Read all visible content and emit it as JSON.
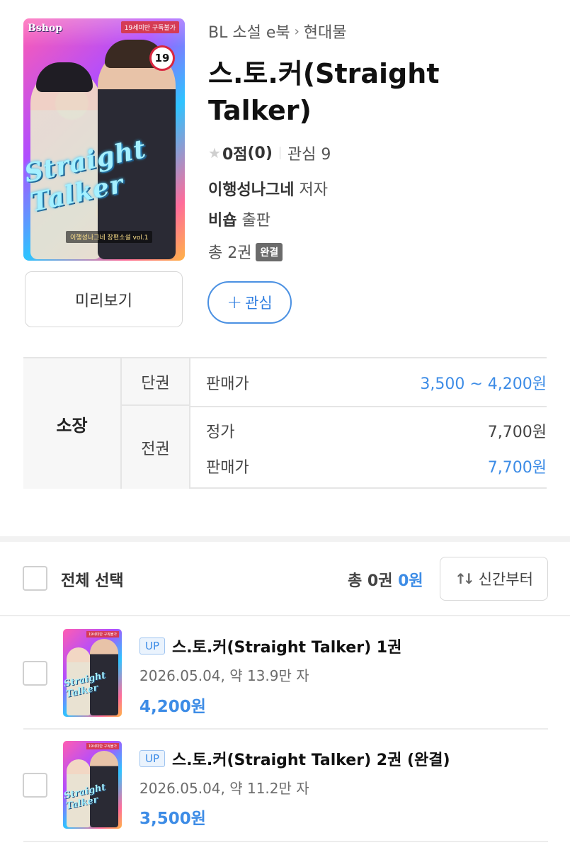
{
  "cover": {
    "brand": "Bshop",
    "age_notice": "19세미만 구독불가",
    "age_badge": "19",
    "script_title": "Straight Talker",
    "subtitle": "이행성나그네 장편소설 vol.1"
  },
  "breadcrumb": {
    "category": "BL 소설 e북",
    "subcategory": "현대물"
  },
  "book": {
    "title": "스.토.커(Straight Talker)",
    "rating_score": "0점",
    "rating_count": "(0)",
    "wish_count": "관심 9",
    "author_name": "이행성나그네",
    "author_suffix": "저자",
    "publisher_name": "비숍",
    "publisher_suffix": "출판",
    "volumes": "총 2권",
    "status_badge": "완결"
  },
  "actions": {
    "preview": "미리보기",
    "wish": "관심"
  },
  "price_table": {
    "own_label": "소장",
    "single_label": "단권",
    "single_sale_label": "판매가",
    "single_sale_value": "3,500 ~ 4,200원",
    "set_label": "전권",
    "set_list_label": "정가",
    "set_list_value": "7,700원",
    "set_sale_label": "판매가",
    "set_sale_value": "7,700원"
  },
  "list_header": {
    "select_all": "전체 선택",
    "total_prefix": "총 0권",
    "total_price": "0원",
    "sort": "신간부터"
  },
  "items": [
    {
      "badge": "UP",
      "title": "스.토.커(Straight Talker) 1권",
      "meta": "2026.05.04, 약 13.9만 자",
      "price": "4,200원"
    },
    {
      "badge": "UP",
      "title": "스.토.커(Straight Talker) 2권 (완결)",
      "meta": "2026.05.04, 약 11.2만 자",
      "price": "3,500원"
    }
  ],
  "colors": {
    "accent_blue": "#3d8ce6",
    "adult_red": "#d9263f",
    "status_gray": "#6b6b6b"
  }
}
